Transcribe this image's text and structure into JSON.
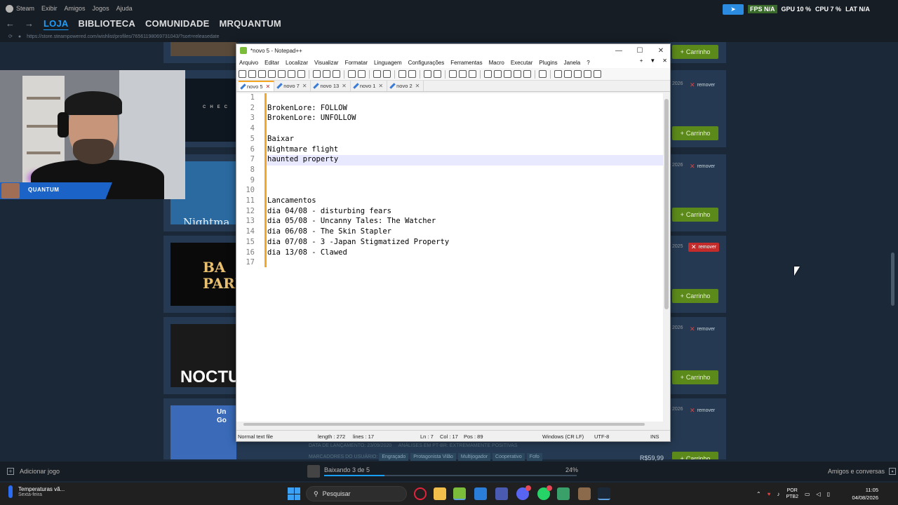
{
  "steam": {
    "menu": [
      "Steam",
      "Exibir",
      "Amigos",
      "Jogos",
      "Ajuda"
    ],
    "tabs": [
      "LOJA",
      "BIBLIOTECA",
      "COMUNIDADE",
      "MRQUANTUM"
    ],
    "url": "https://store.steampowered.com/wishlist/profiles/76561198069731043/?sort=releasedate"
  },
  "hud": {
    "fps": "FPS N/A",
    "gpu": "GPU 10 %",
    "cpu": "CPU 7 %",
    "lat": "LAT N/A"
  },
  "wishlist": {
    "cart_label": "Carrinho",
    "remove_label": "remover",
    "date_fragments": [
      "2026",
      "2026",
      "2025",
      "2026",
      "2026"
    ],
    "thumbs": [
      "",
      "CHEC",
      "Nightma",
      "BA PARE",
      "NOCTU",
      "Un Go"
    ],
    "bottom": {
      "release_label": "DATA DE LANÇAMENTO:",
      "release_date": "23/09/2020",
      "reviews": "ANÁLISES EM PT-BR: EXTREMAMENTE POSITIVAS",
      "tags_label": "MARCADORES DO USUÁRIO:",
      "tags": [
        "Engraçado",
        "Protagonista Vilão",
        "Multijogador",
        "Cooperativo",
        "Fofo"
      ],
      "price": "R$59,99"
    }
  },
  "webcam": {
    "name": "QUANTUM"
  },
  "npp": {
    "title": "*novo 5 - Notepad++",
    "menu": [
      "Arquivo",
      "Editar",
      "Localizar",
      "Visualizar",
      "Formatar",
      "Linguagem",
      "Configurações",
      "Ferramentas",
      "Macro",
      "Executar",
      "Plugins",
      "Janela",
      "?"
    ],
    "menu_right": [
      "+",
      "▼",
      "✕"
    ],
    "tabs": [
      "novo 5",
      "novo 7",
      "novo 13",
      "novo 1",
      "novo 2"
    ],
    "lines": [
      "",
      "BrokenLore: FOLLOW",
      "BrokenLore: UNFOLLOW",
      "",
      "Baixar",
      "Nightmare flight",
      "haunted property",
      "",
      "",
      "",
      "Lancamentos",
      "dia 04/08 - disturbing fears",
      "dia 05/08 - Uncanny Tales: The Watcher",
      "dia 06/08 - The Skin Stapler",
      "dia 07/08 - 3 -Japan Stigmatized Property",
      "dia 13/08 - Clawed",
      ""
    ],
    "line_numbers": [
      "1",
      "2",
      "3",
      "4",
      "5",
      "6",
      "7",
      "8",
      "9",
      "10",
      "11",
      "12",
      "13",
      "14",
      "15",
      "16",
      "17"
    ],
    "status": {
      "type": "Normal text file",
      "length": "length : 272",
      "lines": "lines : 17",
      "ln": "Ln : 7",
      "col": "Col : 17",
      "pos": "Pos : 89",
      "eol": "Windows (CR LF)",
      "enc": "UTF-8",
      "mode": "INS"
    }
  },
  "steam_bottom": {
    "add_game": "Adicionar jogo",
    "download": "Baixando 3 de 5",
    "download_pct": "24%",
    "download_progress": 0.24,
    "friends": "Amigos e conversas"
  },
  "taskbar": {
    "weather_title": "Temperaturas vã...",
    "weather_sub": "Sexta-feira",
    "search_placeholder": "Pesquisar",
    "lang_top": "POR",
    "lang_bottom": "PTB2",
    "time": "11:05",
    "date": "04/08/2026"
  },
  "colors": {
    "steam_bg": "#1b2838",
    "accent": "#1a9fff",
    "cart_green": "#5c8a1a",
    "npp_fold": "#f5a623"
  }
}
